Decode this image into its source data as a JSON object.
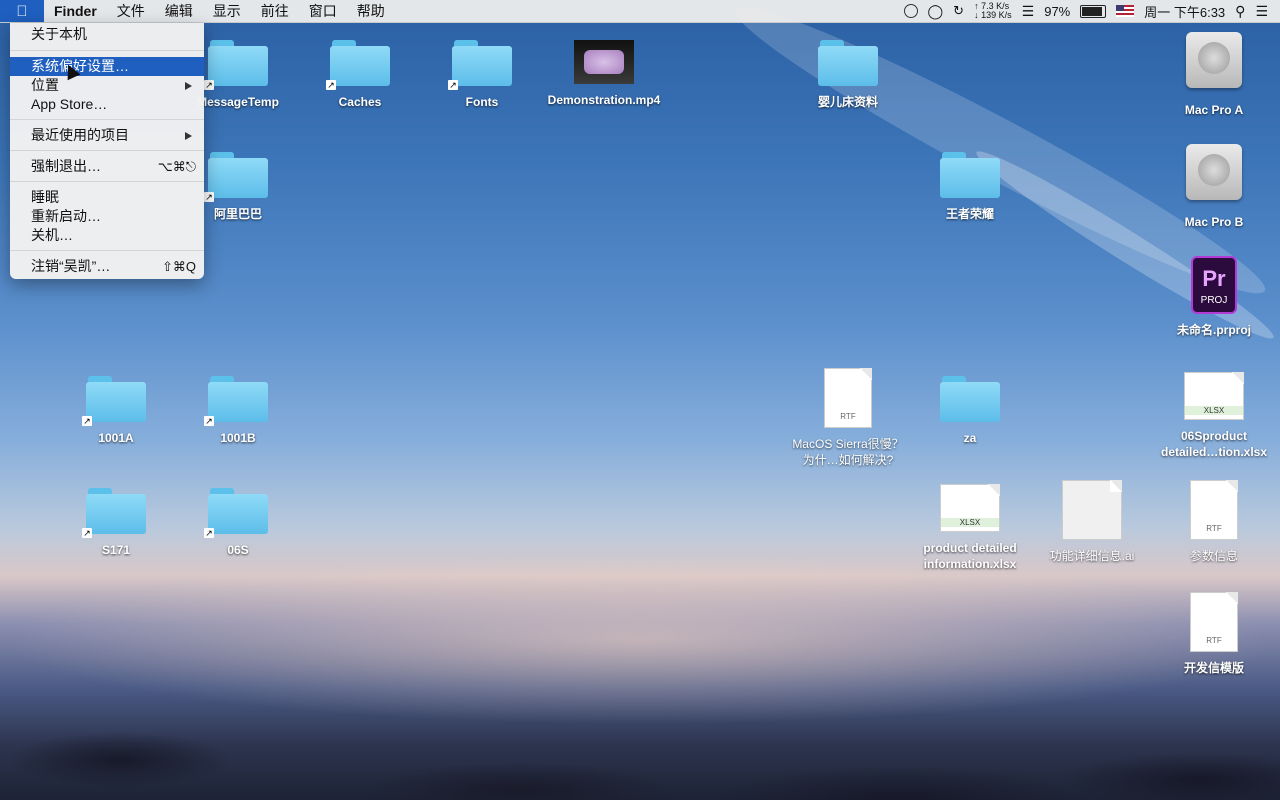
{
  "menubar": {
    "apple_icon": "apple-icon",
    "app": "Finder",
    "items": [
      "文件",
      "编辑",
      "显示",
      "前往",
      "窗口",
      "帮助"
    ],
    "status": {
      "network_up": "7.3",
      "network_down": "139",
      "net_unit": "K/s",
      "battery": "97%",
      "battery_fraction": 0.97,
      "datetime": "周一 下午6:33"
    }
  },
  "apple_menu": {
    "about": "关于本机",
    "preferences": "系统偏好设置…",
    "location": "位置",
    "appstore": "App Store…",
    "recent": "最近使用的项目",
    "force_quit": "强制退出…",
    "force_quit_shortcut": "⌥⌘⎋",
    "sleep": "睡眠",
    "restart": "重新启动…",
    "shutdown": "关机…",
    "logout": "注销“吴凯”…",
    "logout_shortcut": "⇧⌘Q"
  },
  "desktop": {
    "messagetemp": "MessageTemp",
    "caches": "Caches",
    "fonts": "Fonts",
    "demo_video": "Demonstration.mp4",
    "crib": "婴儿床资料",
    "macpro_a": "Mac Pro A",
    "alibaba": "阿里巴巴",
    "wangzhe": "王者荣耀",
    "macpro_b": "Mac Pro B",
    "prproj": "未命名.prproj",
    "prproj_badge": "Pr",
    "prproj_tag": "PROJ",
    "f1001a": "1001A",
    "f1001b": "1001B",
    "macos_rtf": "MacOS Sierra很慢？为什…如何解决?",
    "za": "za",
    "xlsx_06s": "06Sproduct detailed…tion.xlsx",
    "s171": "S171",
    "f06s": "06S",
    "product_xlsx": "product detailed information.xlsx",
    "ai_file": "功能详细信息.ai",
    "params_rtf": "参数信息",
    "template_rtf": "开发信模版",
    "rtf_tag": "RTF",
    "xlsx_tag": "XLSX"
  }
}
